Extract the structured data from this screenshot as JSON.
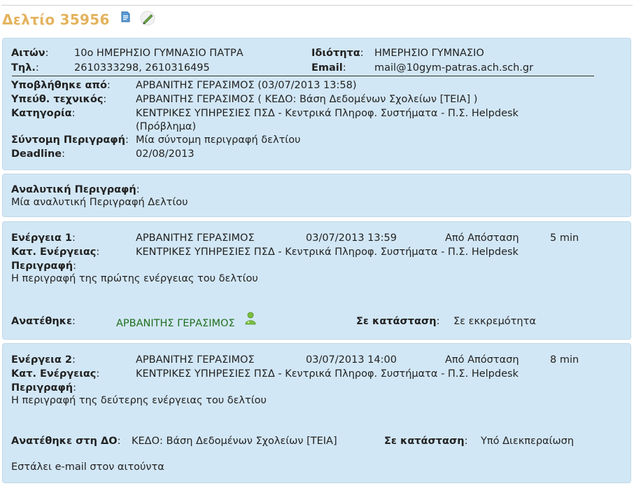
{
  "header": {
    "title": "Δελτίο 35956",
    "doc_icon": "document-icon",
    "edit_icon": "pencil-edit-icon"
  },
  "info": {
    "requester_label": "Αιτών",
    "requester_value": "10ο ΗΜΕΡΗΣΙΟ ΓΥΜΝΑΣΙΟ ΠΑΤΡΑ",
    "type_label": "Ιδιότητα",
    "type_value": "ΗΜΕΡΗΣΙΟ ΓΥΜΝΑΣΙΟ",
    "phone_label": "Τηλ.",
    "phone_value": "2610333298, 2610316495",
    "email_label": "Email",
    "email_value": "mail@10gym-patras.ach.sch.gr",
    "submitted_label": "Υποβλήθηκε από",
    "submitted_value": "ΑΡΒΑΝΙΤΗΣ ΓΕΡΑΣΙΜΟΣ (03/07/2013 13:58)",
    "tech_label": "Υπεύθ. τεχνικός",
    "tech_value": "ΑΡΒΑΝΙΤΗΣ ΓΕΡΑΣΙΜΟΣ ( ΚΕΔΟ: Βάση Δεδομένων Σχολείων [ΤΕΙΑ] )",
    "category_label": "Κατηγορία",
    "category_value_1": "ΚΕΝΤΡΙΚΕΣ ΥΠΗΡΕΣΙΕΣ ΠΣΔ - Κεντρικά Πληροφ. Συστήματα - Π.Σ. Helpdesk",
    "category_value_2": "(Πρόβλημα)",
    "short_desc_label": "Σύντομη Περιγραφή",
    "short_desc_value": "Μία σύντομη περιγραφή δελτίου",
    "deadline_label": "Deadline",
    "deadline_value": "02/08/2013"
  },
  "details": {
    "label": "Αναλυτική Περιγραφή",
    "value": "Μία αναλυτική Περιγραφή Δελτίου"
  },
  "actions": [
    {
      "label": "Ενέργεια 1",
      "person": "ΑΡΒΑΝΙΤΗΣ ΓΕΡΑΣΙΜΟΣ",
      "datetime": "03/07/2013 13:59",
      "mode": "Από Απόσταση",
      "duration": "5 min",
      "type_label": "Κατ. Ενέργειας",
      "type_value": "ΚΕΝΤΡΙΚΕΣ ΥΠΗΡΕΣΙΕΣ ΠΣΔ - Κεντρικά Πληροφ. Συστήματα - Π.Σ. Helpdesk",
      "desc_label": "Περιγραφή",
      "desc_value": "Η περιγραφή της πρώτης ενέργειας του δελτίου",
      "assigned_label": "Ανατέθηκε",
      "assigned_value": "ΑΡΒΑΝΙΤΗΣ ΓΕΡΑΣΙΜΟΣ",
      "status_label": "Σε κατάσταση",
      "status_value": "Σε εκκρεμότητα"
    },
    {
      "label": "Ενέργεια 2",
      "person": "ΑΡΒΑΝΙΤΗΣ ΓΕΡΑΣΙΜΟΣ",
      "datetime": "03/07/2013 14:00",
      "mode": "Από Απόσταση",
      "duration": "8 min",
      "type_label": "Κατ. Ενέργειας",
      "type_value": "ΚΕΝΤΡΙΚΕΣ ΥΠΗΡΕΣΙΕΣ ΠΣΔ - Κεντρικά Πληροφ. Συστήματα - Π.Σ. Helpdesk",
      "desc_label": "Περιγραφή",
      "desc_value": "Η περιγραφή της δεύτερης ενέργειας του δελτίου",
      "assigned_label": "Ανατέθηκε στη ΔΟ",
      "assigned_value": "ΚΕΔΟ: Βάση Δεδομένων Σχολείων [ΤΕΙΑ]",
      "status_label": "Σε κατάσταση",
      "status_value": "Υπό Διεκπεραίωση",
      "email_note": "Εστάλει e-mail στον αιτούντα"
    }
  ],
  "colors": {
    "title": "#e4b35d",
    "panel_bg": "#d2e7f5",
    "assignee_green": "#1f6f1f"
  }
}
